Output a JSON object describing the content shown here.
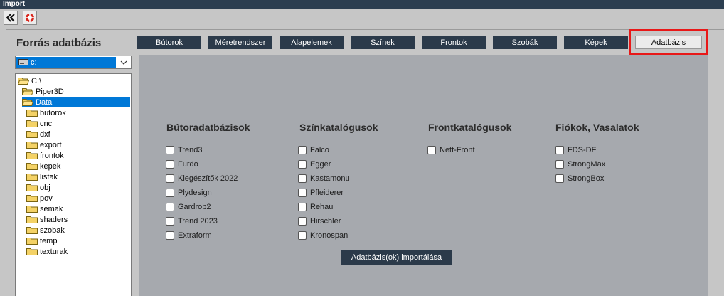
{
  "window": {
    "title": "Import"
  },
  "toolbar": {
    "back_icon": "double-chevron-left-icon",
    "help_icon": "lifebuoy-icon"
  },
  "source": {
    "title": "Forrás adatbázis",
    "drive": "c:"
  },
  "tree": [
    {
      "label": "C:\\"
    },
    {
      "label": "Piper3D"
    },
    {
      "label": "Data"
    },
    {
      "label": "butorok"
    },
    {
      "label": "cnc"
    },
    {
      "label": "dxf"
    },
    {
      "label": "export"
    },
    {
      "label": "frontok"
    },
    {
      "label": "kepek"
    },
    {
      "label": "listak"
    },
    {
      "label": "obj"
    },
    {
      "label": "pov"
    },
    {
      "label": "semak"
    },
    {
      "label": "shaders"
    },
    {
      "label": "szobak"
    },
    {
      "label": "temp"
    },
    {
      "label": "texturak"
    }
  ],
  "tabs": [
    {
      "label": "Bútorok"
    },
    {
      "label": "Méretrendszer"
    },
    {
      "label": "Alapelemek"
    },
    {
      "label": "Színek"
    },
    {
      "label": "Frontok"
    },
    {
      "label": "Szobák"
    },
    {
      "label": "Képek"
    },
    {
      "label": "Adatbázis"
    }
  ],
  "columns": [
    {
      "title": "Bútoradatbázisok",
      "items": [
        "Trend3",
        "Furdo",
        "Kiegészítők 2022",
        "Plydesign",
        "Gardrob2",
        "Trend 2023",
        "Extraform"
      ]
    },
    {
      "title": "Színkatalógusok",
      "items": [
        "Falco",
        "Egger",
        "Kastamonu",
        "Pfleiderer",
        "Rehau",
        "Hirschler",
        "Kronospan"
      ]
    },
    {
      "title": "Frontkatalógusok",
      "items": [
        "Nett-Front"
      ]
    },
    {
      "title": "Fiókok, Vasalatok",
      "items": [
        "FDS-DF",
        "StrongMax",
        "StrongBox"
      ]
    }
  ],
  "import_button": "Adatbázis(ok) importálása"
}
